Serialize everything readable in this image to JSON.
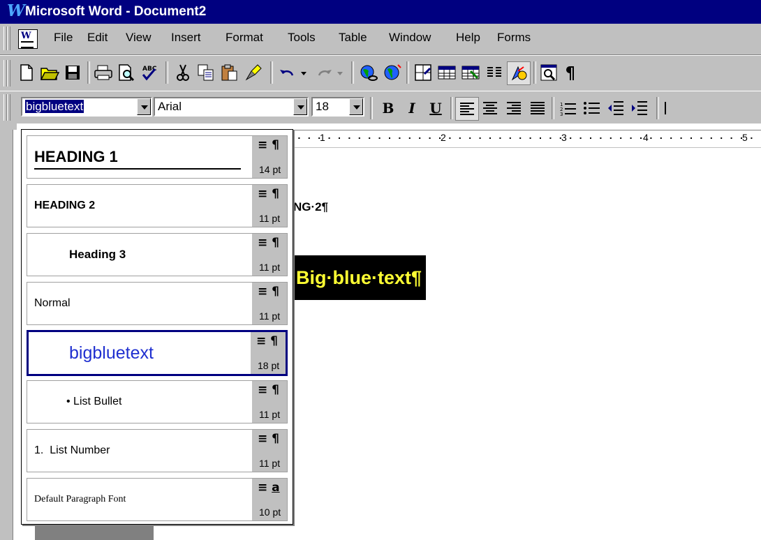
{
  "window": {
    "title": "Microsoft Word - Document2",
    "app_glyph": "W"
  },
  "menu": {
    "items": [
      "File",
      "Edit",
      "View",
      "Insert",
      "Format",
      "Tools",
      "Table",
      "Window",
      "Help",
      "Forms"
    ]
  },
  "toolbar_standard": {
    "icons": [
      "new-icon",
      "open-icon",
      "save-icon",
      "print-icon",
      "print-preview-icon",
      "spelling-icon",
      "cut-icon",
      "copy-icon",
      "paste-icon",
      "format-painter-icon",
      "undo-icon",
      "redo-icon",
      "hyperlink-icon",
      "web-toolbar-icon",
      "tables-borders-icon",
      "insert-table-icon",
      "insert-excel-icon",
      "columns-icon",
      "drawing-icon",
      "document-map-icon",
      "show-hide-icon"
    ]
  },
  "toolbar_formatting": {
    "style_value": "bigbluetext",
    "font_value": "Arial",
    "size_value": "18",
    "bold_label": "B",
    "italic_label": "I",
    "underline_label": "U"
  },
  "ruler": {
    "labels": [
      "1",
      "2",
      "3",
      "4",
      "5"
    ]
  },
  "document": {
    "heading2_fragment": "NG·2¶",
    "big_blue_text": "Big·blue·text¶"
  },
  "style_list": [
    {
      "name": "HEADING 1",
      "size": "14 pt",
      "mark": "¶"
    },
    {
      "name": "HEADING 2",
      "size": "11 pt",
      "mark": "¶"
    },
    {
      "name": "Heading 3",
      "size": "11 pt",
      "mark": "¶"
    },
    {
      "name": "Normal",
      "size": "11 pt",
      "mark": "¶"
    },
    {
      "name": "bigbluetext",
      "size": "18 pt",
      "mark": "¶"
    },
    {
      "name": "• List Bullet",
      "size": "11 pt",
      "mark": "¶"
    },
    {
      "name": "1.  List Number",
      "size": "11 pt",
      "mark": "¶"
    },
    {
      "name": "Default Paragraph Font",
      "size": "10 pt",
      "mark": "a"
    }
  ],
  "colors": {
    "titlebar": "#000080",
    "face": "#c0c0c0",
    "selection": "#000080",
    "bigblue_style": "#1f2fd0",
    "doc_highlight_text": "#ffff33"
  }
}
